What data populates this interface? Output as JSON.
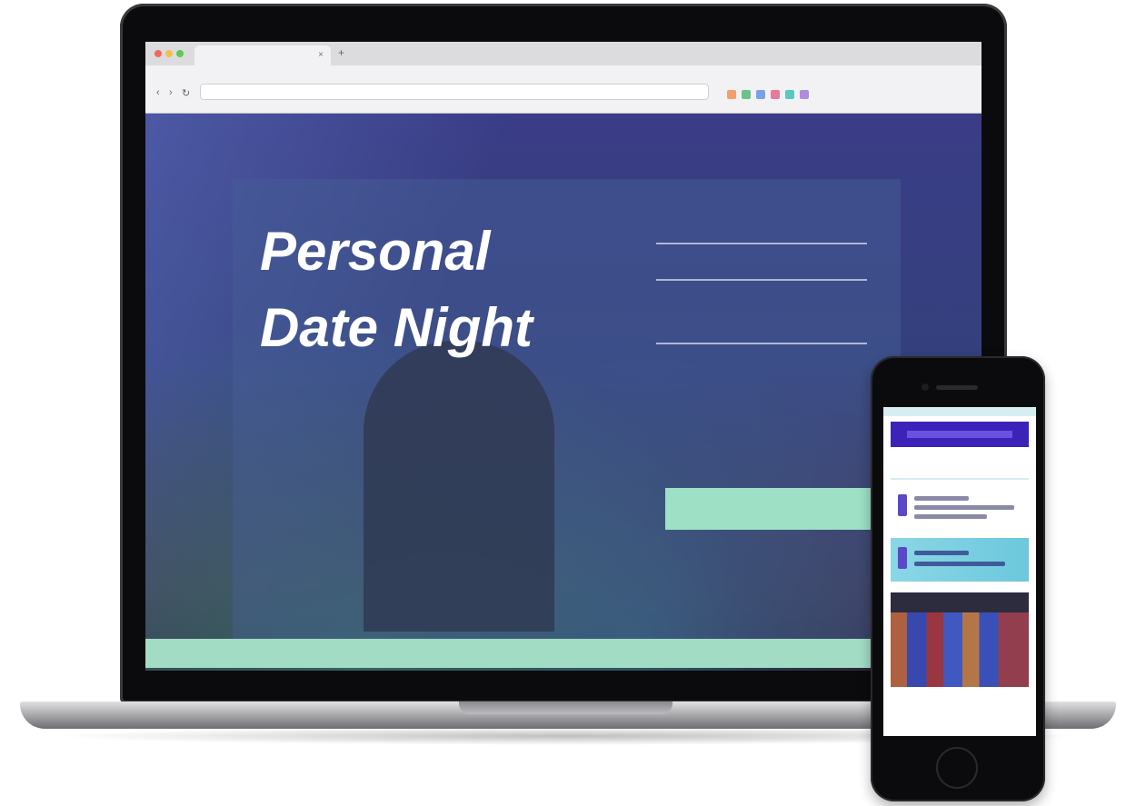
{
  "browser": {
    "tab_title": "",
    "url": "",
    "extension_colors": [
      "#f0a070",
      "#6dc28a",
      "#7aa0e8",
      "#e87a9a",
      "#5ac8c0",
      "#b08ae0"
    ]
  },
  "hero": {
    "title_line1": "Personal",
    "title_line2": "Date Night",
    "description": ""
  },
  "form": {
    "heading": "",
    "fields": [
      {
        "label": "",
        "value": ""
      },
      {
        "label": "",
        "value": ""
      },
      {
        "label": "",
        "value": ""
      }
    ],
    "submit_label": ""
  },
  "footer": {
    "text": ""
  },
  "mobile": {
    "nav_text": "",
    "caption": "",
    "subcaption": ""
  },
  "colors": {
    "accent_mint": "#9ee0c6",
    "footer_mint": "#a3dcc5",
    "page_purple": "#3a3d86",
    "mobile_header": "#3c22b8"
  }
}
